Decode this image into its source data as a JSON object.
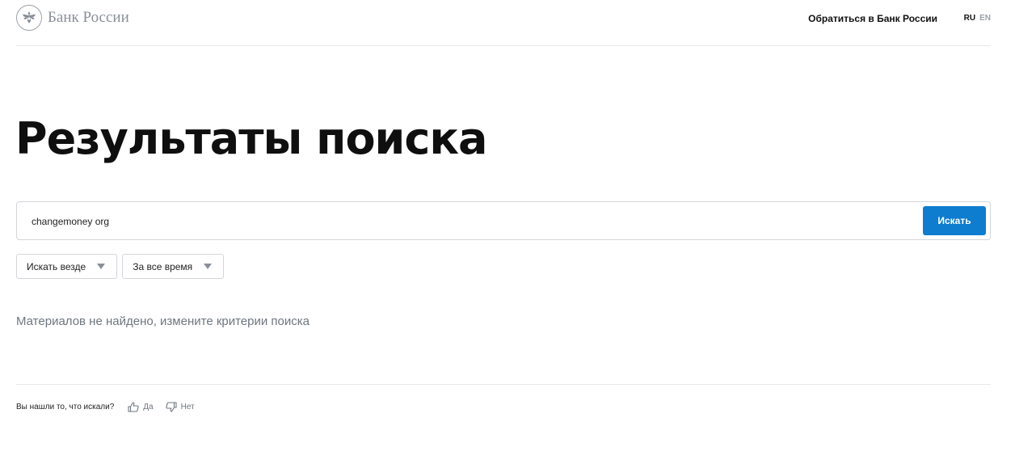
{
  "header": {
    "logo_text": "Банк России",
    "contact_link": "Обратиться в Банк России",
    "lang": {
      "ru": "RU",
      "en": "EN"
    }
  },
  "page_title": "Результаты поиска",
  "search": {
    "value": "changemoney org",
    "button_label": "Искать"
  },
  "filters": [
    {
      "label": "Искать везде"
    },
    {
      "label": "За все время"
    }
  ],
  "results_message": "Материалов не найдено, измените критерии поиска",
  "feedback": {
    "question": "Вы нашли то, что искали?",
    "yes_label": "Да",
    "no_label": "Нет"
  },
  "icons": {
    "logo": "double-headed-eagle-emblem",
    "caret": "triangle-down-icon",
    "yes": "thumbs-up-icon",
    "no": "thumbs-down-icon"
  },
  "colors": {
    "accent": "#0e7dcf",
    "muted_text": "#6f767e",
    "border": "#d3d6da"
  }
}
